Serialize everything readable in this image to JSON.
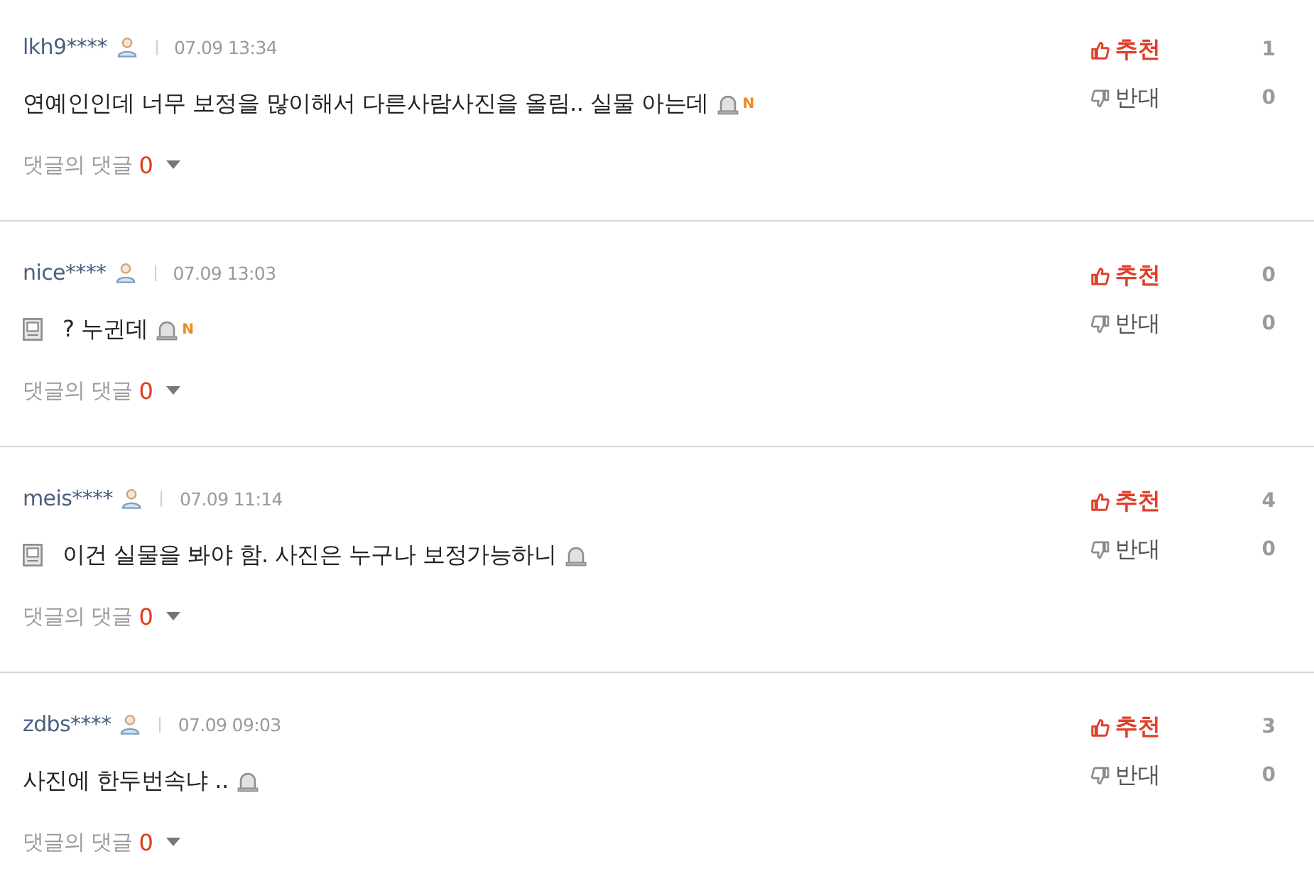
{
  "comments": [
    {
      "user": "lkh9****",
      "time": "07.09 13:34",
      "leading_icon": false,
      "text": "연예인인데 너무 보정을 많이해서 다른사람사진을 올림.. 실물 아는데",
      "new_badge": "N",
      "replies": {
        "label": "댓글의 댓글",
        "count": "0"
      },
      "recommend": {
        "label": "추천",
        "count": "1"
      },
      "oppose": {
        "label": "반대",
        "count": "0"
      }
    },
    {
      "user": "nice****",
      "time": "07.09 13:03",
      "leading_icon": true,
      "text": "? 누귄데",
      "new_badge": "N",
      "replies": {
        "label": "댓글의 댓글",
        "count": "0"
      },
      "recommend": {
        "label": "추천",
        "count": "0"
      },
      "oppose": {
        "label": "반대",
        "count": "0"
      }
    },
    {
      "user": "meis****",
      "time": "07.09 11:14",
      "leading_icon": true,
      "text": "이건 실물을 봐야 함. 사진은 누구나 보정가능하니",
      "replies": {
        "label": "댓글의 댓글",
        "count": "0"
      },
      "recommend": {
        "label": "추천",
        "count": "4"
      },
      "oppose": {
        "label": "반대",
        "count": "0"
      }
    },
    {
      "user": "zdbs****",
      "time": "07.09 09:03",
      "leading_icon": false,
      "text": "사진에 한두번속냐 ..",
      "replies": {
        "label": "댓글의 댓글",
        "count": "0"
      },
      "recommend": {
        "label": "추천",
        "count": "3"
      },
      "oppose": {
        "label": "반대",
        "count": "0"
      }
    }
  ]
}
